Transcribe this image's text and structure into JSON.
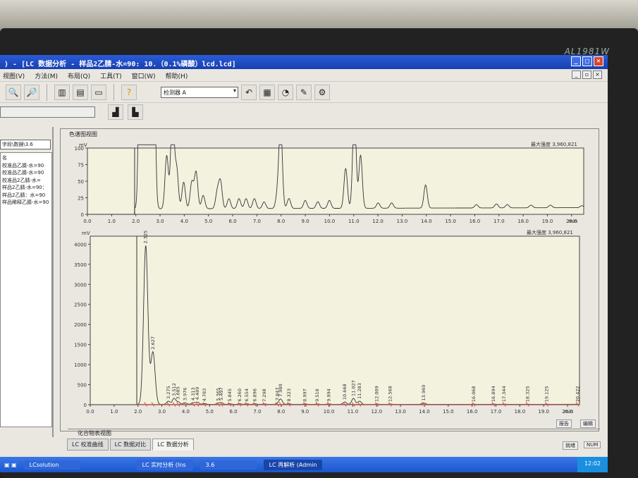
{
  "monitor": {
    "brand": "AL1981W"
  },
  "window": {
    "title": "[LC 数据分析 - 样品2乙腈-水=90: 10.（0.1%磷酸）lcd.lcd]",
    "prefix": ") -"
  },
  "menu": [
    "视图(V)",
    "方法(M)",
    "布局(Q)",
    "工具(T)",
    "窗口(W)",
    "帮助(H)"
  ],
  "toolbar": {
    "detector_select": "检测器 A"
  },
  "left_panel": {
    "combo": "字段\\数据\\3.6",
    "header": "名",
    "items": [
      "校准品乙腈-水=90",
      "校准品乙腈-水=90",
      "校准品2乙腈-水=",
      "样品2乙腈-水=90：",
      "样品2乙腈：水=90",
      "样品稀释乙腈-水=90"
    ]
  },
  "chromatogram_view": {
    "title": "色谱图视图",
    "max_intensity_label": "最大强度 3,960,821",
    "y_unit": "mV",
    "x_unit": "min",
    "report_button": "报告",
    "edit_button": "编辑"
  },
  "compound_view": {
    "title": "化合物表视图"
  },
  "tabs": [
    "LC 校准曲线",
    "LC 数据对比",
    "LC 数据分析"
  ],
  "status": {
    "left": "就绪",
    "right": "NUM"
  },
  "taskbar": {
    "items": [
      "LCsolution",
      "LC 实时分析 (Ins",
      "3.6",
      "LC 再解析 (Admin"
    ],
    "clock": "12:02"
  },
  "chart_data": [
    {
      "type": "line",
      "title": "detector A (zoomed)",
      "xlabel": "min",
      "ylabel": "mV",
      "xlim": [
        0,
        20.5
      ],
      "ylim": [
        0,
        100
      ],
      "yticks": [
        0,
        25,
        50,
        75,
        100
      ],
      "xticks": [
        0,
        1,
        2,
        3,
        4,
        5,
        6,
        7,
        8,
        9,
        10,
        11,
        12,
        13,
        14,
        15,
        16,
        17,
        18,
        19,
        20
      ]
    },
    {
      "type": "line",
      "title": "detector A",
      "xlabel": "min",
      "ylabel": "mV",
      "xlim": [
        0,
        20.5
      ],
      "ylim": [
        0,
        4200
      ],
      "yticks": [
        0,
        500,
        1000,
        1500,
        2000,
        2500,
        3000,
        3500,
        4000
      ],
      "xticks": [
        0,
        1,
        2,
        3,
        4,
        5,
        6,
        7,
        8,
        9,
        10,
        11,
        12,
        13,
        14,
        15,
        16,
        17,
        18,
        19,
        20
      ],
      "peaks": [
        {
          "rt": 2.325,
          "height": 3950
        },
        {
          "rt": 2.627,
          "height": 1300
        },
        {
          "rt": 3.275,
          "height": 80
        },
        {
          "rt": 3.512,
          "height": 150
        },
        {
          "rt": 3.685,
          "height": 60
        },
        {
          "rt": 3.976,
          "height": 40
        },
        {
          "rt": 4.313,
          "height": 40
        },
        {
          "rt": 4.489,
          "height": 55
        },
        {
          "rt": 4.783,
          "height": 20
        },
        {
          "rt": 5.365,
          "height": 25
        },
        {
          "rt": 5.497,
          "height": 40
        },
        {
          "rt": 5.845,
          "height": 15
        },
        {
          "rt": 6.26,
          "height": 15
        },
        {
          "rt": 6.554,
          "height": 15
        },
        {
          "rt": 6.896,
          "height": 15
        },
        {
          "rt": 7.298,
          "height": 10
        },
        {
          "rt": 7.847,
          "height": 20
        },
        {
          "rt": 7.98,
          "height": 130
        },
        {
          "rt": 8.323,
          "height": 15
        },
        {
          "rt": 8.997,
          "height": 12
        },
        {
          "rt": 9.518,
          "height": 10
        },
        {
          "rt": 9.994,
          "height": 12
        },
        {
          "rt": 10.668,
          "height": 60
        },
        {
          "rt": 11.027,
          "height": 150
        },
        {
          "rt": 11.283,
          "height": 80
        },
        {
          "rt": 12.009,
          "height": 8
        },
        {
          "rt": 12.568,
          "height": 8
        },
        {
          "rt": 13.969,
          "height": 35
        },
        {
          "rt": 16.068,
          "height": 5
        },
        {
          "rt": 16.894,
          "height": 6
        },
        {
          "rt": 17.344,
          "height": 5
        },
        {
          "rt": 18.325,
          "height": 4
        },
        {
          "rt": 19.125,
          "height": 4
        },
        {
          "rt": 20.422,
          "height": 3
        }
      ]
    }
  ]
}
